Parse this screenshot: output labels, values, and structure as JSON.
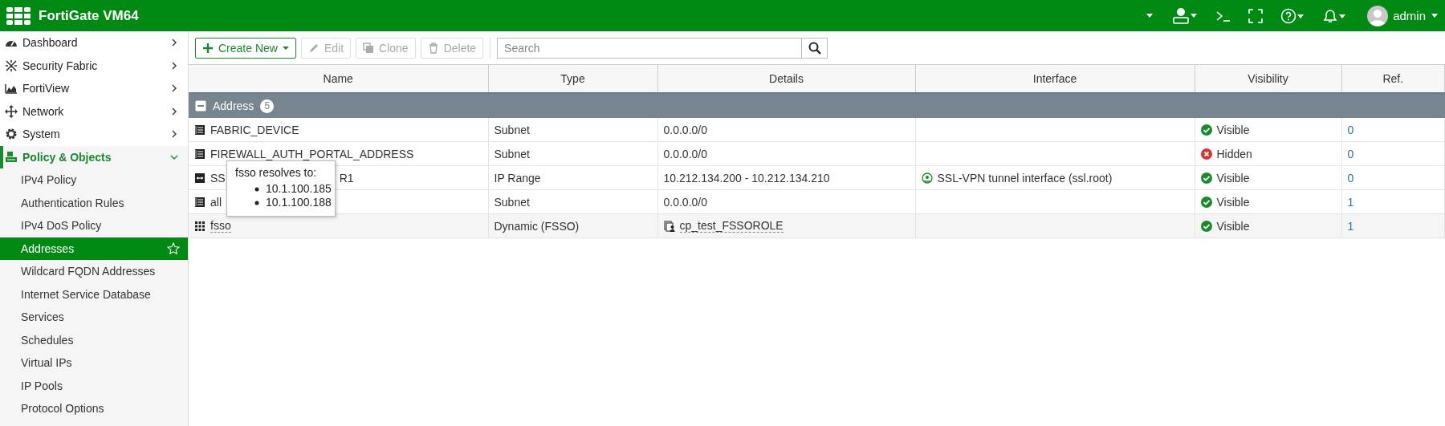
{
  "header": {
    "title": "FortiGate VM64",
    "user": "admin"
  },
  "sidebar": {
    "items": [
      {
        "label": "Dashboard",
        "expanded": false
      },
      {
        "label": "Security Fabric",
        "expanded": false
      },
      {
        "label": "FortiView",
        "expanded": false
      },
      {
        "label": "Network",
        "expanded": false
      },
      {
        "label": "System",
        "expanded": false
      },
      {
        "label": "Policy & Objects",
        "expanded": true,
        "children": [
          {
            "label": "IPv4 Policy",
            "selected": false
          },
          {
            "label": "Authentication Rules",
            "selected": false
          },
          {
            "label": "IPv4 DoS Policy",
            "selected": false
          },
          {
            "label": "Addresses",
            "selected": true
          },
          {
            "label": "Wildcard FQDN Addresses",
            "selected": false
          },
          {
            "label": "Internet Service Database",
            "selected": false
          },
          {
            "label": "Services",
            "selected": false
          },
          {
            "label": "Schedules",
            "selected": false
          },
          {
            "label": "Virtual IPs",
            "selected": false
          },
          {
            "label": "IP Pools",
            "selected": false
          },
          {
            "label": "Protocol Options",
            "selected": false
          }
        ]
      }
    ]
  },
  "toolbar": {
    "buttons": [
      {
        "label": "Create New",
        "kind": "create",
        "disabled": false
      },
      {
        "label": "Edit",
        "kind": "edit",
        "disabled": true
      },
      {
        "label": "Clone",
        "kind": "clone",
        "disabled": true
      },
      {
        "label": "Delete",
        "kind": "delete",
        "disabled": true
      }
    ],
    "search": {
      "placeholder": "Search"
    }
  },
  "table": {
    "columns": [
      "Name",
      "Type",
      "Details",
      "Interface",
      "Visibility",
      "Ref."
    ],
    "group": {
      "label": "Address",
      "count": "5",
      "expanded": true
    },
    "rows": [
      {
        "kind": "subnet",
        "name_parts": [
          "FABRIC_DEVICE"
        ],
        "type": "Subnet",
        "details": "0.0.0.0/0",
        "interface": "",
        "visible": true,
        "visibility": "Visible",
        "ref": "0"
      },
      {
        "kind": "subnet",
        "name_parts": [
          "FIREWALL_AUTH_PORTAL_ADDRESS"
        ],
        "type": "Subnet",
        "details": "0.0.0.0/0",
        "interface": "",
        "visible": false,
        "visibility": "Hidden",
        "ref": "0"
      },
      {
        "kind": "iprange",
        "name_parts": [
          "SS",
          "R1"
        ],
        "type": "IP Range",
        "details": "10.212.134.200 - 10.212.134.210",
        "interface": "SSL-VPN tunnel interface (ssl.root)",
        "visible": true,
        "visibility": "Visible",
        "ref": "0"
      },
      {
        "kind": "subnet",
        "name_parts": [
          "all"
        ],
        "type": "Subnet",
        "details": "0.0.0.0/0",
        "interface": "",
        "visible": true,
        "visibility": "Visible",
        "ref": "1"
      },
      {
        "kind": "fsso",
        "name_parts": [
          "fsso"
        ],
        "type": "Dynamic (FSSO)",
        "details": "cp_test_FSSOROLE",
        "interface": "",
        "visible": true,
        "visibility": "Visible",
        "ref": "1"
      }
    ]
  },
  "tooltip": {
    "title": "fsso resolves to:",
    "items": [
      "10.1.100.185",
      "10.1.100.188"
    ]
  }
}
